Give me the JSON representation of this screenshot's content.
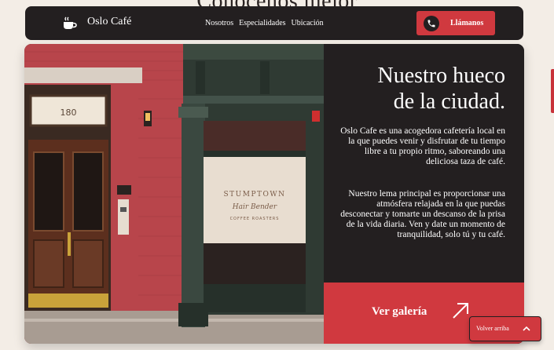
{
  "background": {
    "heading": "Conócenos mejor"
  },
  "navbar": {
    "brand": "Oslo Café",
    "links": [
      "Nosotros",
      "Especialidades",
      "Ubicación"
    ],
    "call_label": "Llámanos"
  },
  "hero": {
    "title_line1": "Nuestro hueco",
    "title_line2": "de la ciudad.",
    "paragraph1": "Oslo Cafe es una acogedora cafetería local en la que puedes venir y disfrutar de tu tiempo libre a tu propio ritmo, saboreando una deliciosa taza de café.",
    "paragraph2": "Nuestro lema principal es proporcionar una atmósfera relajada en la que puedas desconectar y tomarte un descanso de la prisa de la vida diaria. Ven y date un momento de tranquilidad, solo tú y tu café.",
    "gallery_label": "Ver galería"
  },
  "photo": {
    "door_number": "180",
    "sign_line1": "STUMPTOWN",
    "sign_line2": "Hair Bender",
    "sign_line3": "COFFEE ROASTERS"
  },
  "back_to_top": {
    "label": "Volver arriba"
  },
  "colors": {
    "accent": "#d0393f",
    "dark": "#231f20",
    "background": "#f3ede6"
  },
  "icons": [
    "coffee-cup-icon",
    "phone-icon",
    "arrow-up-right-icon",
    "chevron-up-icon"
  ]
}
